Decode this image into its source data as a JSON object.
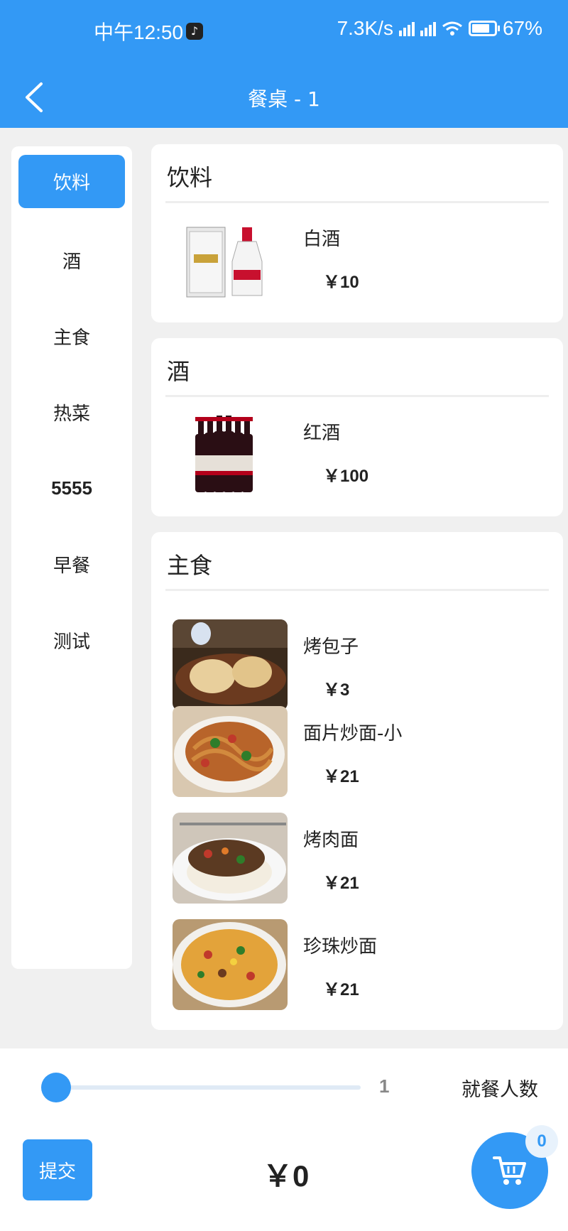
{
  "status_bar": {
    "time": "中午12:50",
    "network_speed": "7.3K/s",
    "battery": "67%"
  },
  "header": {
    "title": "餐桌 - 1",
    "back_icon": "chevron-left-icon"
  },
  "sidebar": {
    "items": [
      {
        "label": "饮料",
        "active": true
      },
      {
        "label": "酒"
      },
      {
        "label": "主食"
      },
      {
        "label": "热菜"
      },
      {
        "label": "5555"
      },
      {
        "label": "早餐"
      },
      {
        "label": "测试"
      }
    ]
  },
  "sections": [
    {
      "title": "饮料",
      "items": [
        {
          "name": "白酒",
          "price": "￥10"
        }
      ]
    },
    {
      "title": "酒",
      "items": [
        {
          "name": "红酒",
          "price": "￥100"
        }
      ]
    },
    {
      "title": "主食",
      "items": [
        {
          "name": "烤包子",
          "price": "￥3"
        },
        {
          "name": "面片炒面-小",
          "price": "￥21"
        },
        {
          "name": "烤肉面",
          "price": "￥21"
        },
        {
          "name": "珍珠炒面",
          "price": "￥21"
        }
      ]
    }
  ],
  "footer": {
    "diners_value": "1",
    "diners_label": "就餐人数",
    "submit_label": "提交",
    "total": "￥0",
    "cart_count": "0"
  },
  "colors": {
    "accent": "#3399f5"
  }
}
